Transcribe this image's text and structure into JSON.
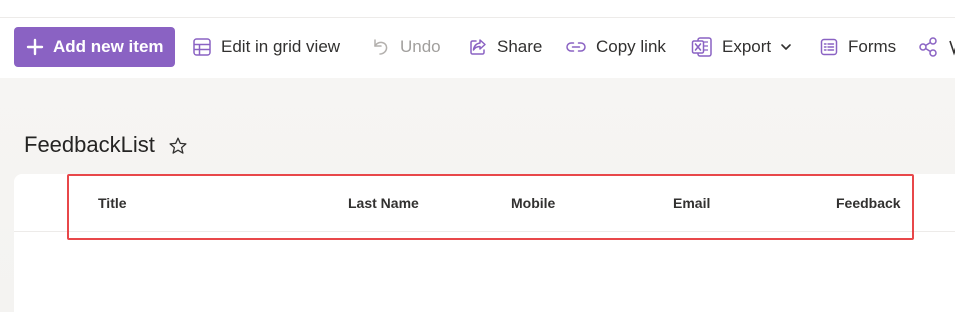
{
  "toolbar": {
    "add_new_item": "Add new item",
    "edit_grid": "Edit in grid view",
    "undo": "Undo",
    "share": "Share",
    "copy_link": "Copy link",
    "export": "Export",
    "forms": "Forms"
  },
  "list": {
    "title": "FeedbackList"
  },
  "columns": [
    "Title",
    "Last Name",
    "Mobile",
    "Email",
    "Feedback"
  ],
  "colors": {
    "accent": "#8a62c3",
    "highlight": "#e8474a"
  }
}
